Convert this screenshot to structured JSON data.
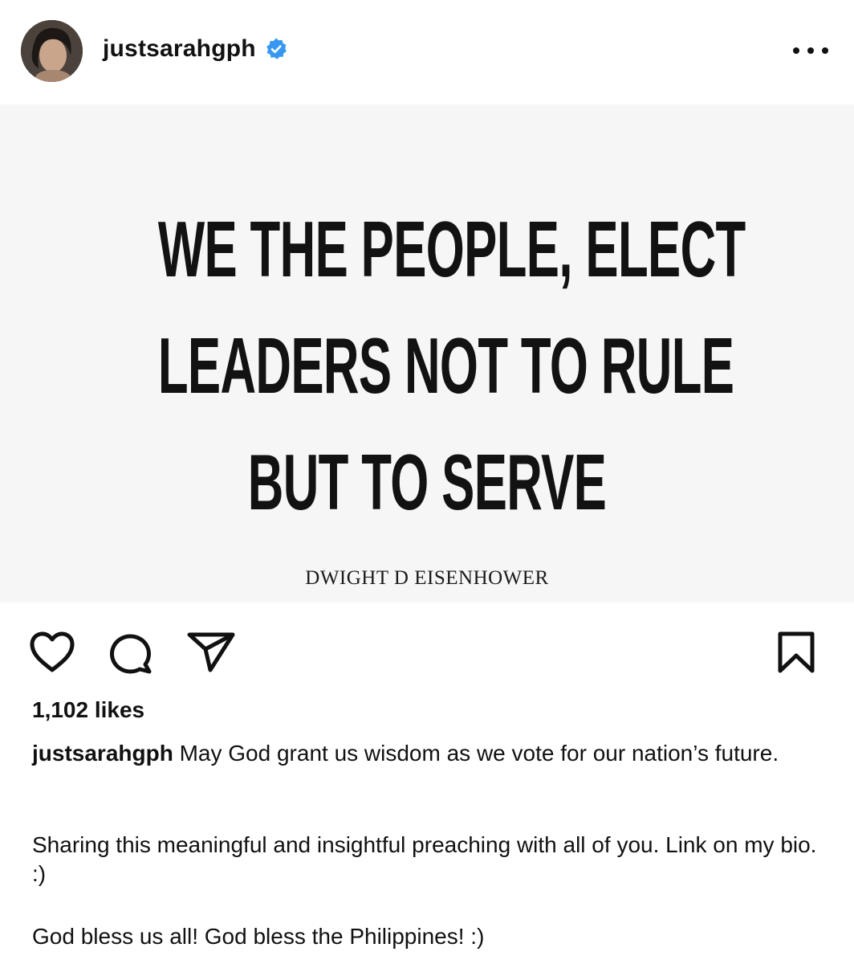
{
  "post": {
    "username": "justsarahgph",
    "verified": true,
    "more_icon": "more-horizontal-icon",
    "image": {
      "quote_lines": [
        "WE THE PEOPLE, ELECT",
        "LEADERS NOT TO RULE",
        "BUT TO SERVE"
      ],
      "author": "DWIGHT D EISENHOWER"
    },
    "actions": {
      "like_icon": "heart-icon",
      "comment_icon": "comment-icon",
      "share_icon": "send-icon",
      "save_icon": "bookmark-icon"
    },
    "likes": "1,102 likes",
    "caption": {
      "username": "justsarahgph",
      "text": " May God grant us wisdom as we vote for our nation’s future.",
      "paragraph_2": "Sharing this meaningful and insightful preaching with all of you. Link on my bio. :)",
      "paragraph_3": "God bless us all! God bless the Philippines! :)"
    }
  },
  "colors": {
    "verified_badge": "#3897f0",
    "text": "#111111",
    "image_background": "#f6f6f6"
  }
}
